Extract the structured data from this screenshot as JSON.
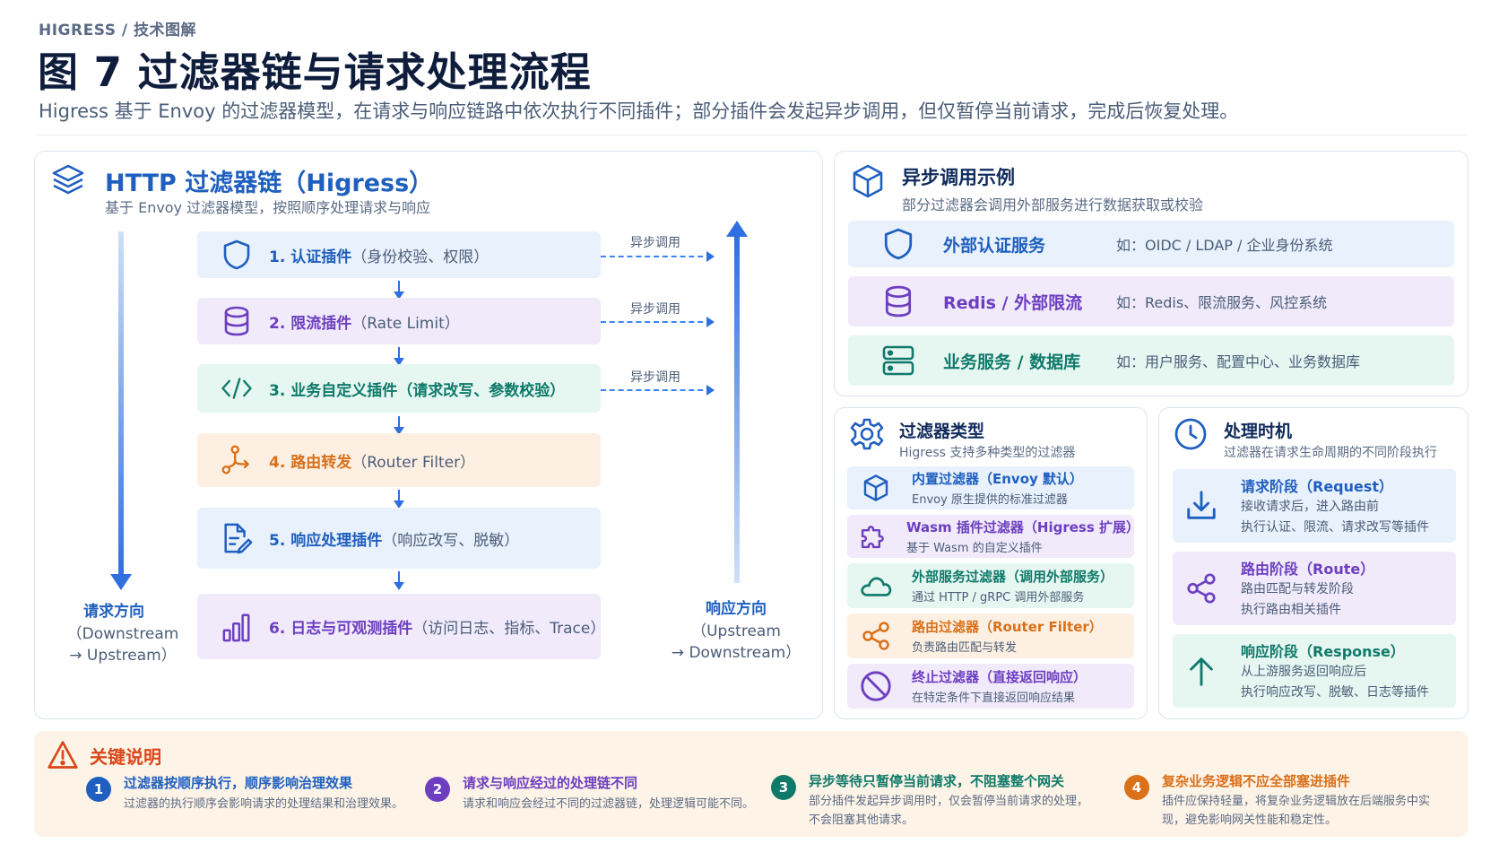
{
  "header": {
    "breadcrumb": "HIGRESS / 技术图解",
    "title": "图 7  过滤器链与请求处理流程",
    "subtitle": "Higress 基于 Envoy 的过滤器模型，在请求与响应链路中依次执行不同插件；部分插件会发起异步调用，但仅暂停当前请求，完成后恢复处理。"
  },
  "chain": {
    "title": "HTTP 过滤器链（Higress）",
    "subtitle": "基于 Envoy 过滤器模型，按照顺序处理请求与响应",
    "steps": [
      {
        "name": "1. 认证插件",
        "desc": "（身份校验、权限）",
        "icon": "shield-icon",
        "color": "#1f5fbf",
        "bg": "#e8f1fc"
      },
      {
        "name": "2. 限流插件",
        "desc": "（Rate Limit）",
        "icon": "database-icon",
        "color": "#6d3fc0",
        "bg": "#f0eafb"
      },
      {
        "name": "3. 业务自定义插件（请求改写、参数校验）",
        "desc": "",
        "icon": "code-icon",
        "color": "#0f7a6a",
        "bg": "#e6f6f1"
      },
      {
        "name": "4. 路由转发",
        "desc": "（Router Filter）",
        "icon": "route-icon",
        "color": "#d9701a",
        "bg": "#fdf0e2"
      },
      {
        "name": "5. 响应处理插件",
        "desc": "（响应改写、脱敏）",
        "icon": "document-edit-icon",
        "color": "#1f5fbf",
        "bg": "#e8f1fc"
      },
      {
        "name": "6. 日志与可观测插件",
        "desc": "（访问日志、指标、Trace）",
        "icon": "bar-chart-icon",
        "color": "#6d3fc0",
        "bg": "#f0eafb"
      }
    ],
    "async_label": "异步调用",
    "request_dir": {
      "title": "请求方向",
      "line1": "（Downstream",
      "line2": "→ Upstream）"
    },
    "response_dir": {
      "title": "响应方向",
      "line1": "（Upstream",
      "line2": "→ Downstream）"
    }
  },
  "async": {
    "title": "异步调用示例",
    "subtitle": "部分过滤器会调用外部服务进行数据获取或校验",
    "services": [
      {
        "name": "外部认证服务",
        "example": "如：OIDC / LDAP / 企业身份系统",
        "icon": "shield-icon",
        "color": "#1f5fbf",
        "bg": "#e8f1fc"
      },
      {
        "name": "Redis / 外部限流",
        "example": "如：Redis、限流服务、风控系统",
        "icon": "database-icon",
        "color": "#6d3fc0",
        "bg": "#f0eafb"
      },
      {
        "name": "业务服务 / 数据库",
        "example": "如：用户服务、配置中心、业务数据库",
        "icon": "server-icon",
        "color": "#0f7a6a",
        "bg": "#e6f6f1"
      }
    ]
  },
  "types": {
    "title": "过滤器类型",
    "subtitle": "Higress 支持多种类型的过滤器",
    "items": [
      {
        "name": "内置过滤器（Envoy 默认）",
        "desc": "Envoy 原生提供的标准过滤器",
        "icon": "cube-icon",
        "color": "#1f5fbf",
        "bg": "#e8f1fc"
      },
      {
        "name": "Wasm 插件过滤器（Higress 扩展）",
        "desc": "基于 Wasm 的自定义插件",
        "icon": "puzzle-icon",
        "color": "#6d3fc0",
        "bg": "#f0eafb"
      },
      {
        "name": "外部服务过滤器（调用外部服务）",
        "desc": "通过 HTTP / gRPC 调用外部服务",
        "icon": "cloud-icon",
        "color": "#0f7a6a",
        "bg": "#e6f6f1"
      },
      {
        "name": "路由过滤器（Router Filter）",
        "desc": "负责路由匹配与转发",
        "icon": "share-icon",
        "color": "#d9701a",
        "bg": "#fdf0e2"
      },
      {
        "name": "终止过滤器（直接返回响应）",
        "desc": "在特定条件下直接返回响应结果",
        "icon": "block-icon",
        "color": "#6d3fc0",
        "bg": "#f0eafb"
      }
    ]
  },
  "timing": {
    "title": "处理时机",
    "subtitle": "过滤器在请求生命周期的不同阶段执行",
    "phases": [
      {
        "name": "请求阶段（Request）",
        "line1": "接收请求后，进入路由前",
        "line2": "执行认证、限流、请求改写等插件",
        "icon": "download-icon",
        "color": "#1f5fbf",
        "bg": "#e8f1fc"
      },
      {
        "name": "路由阶段（Route）",
        "line1": "路由匹配与转发阶段",
        "line2": "执行路由相关插件",
        "icon": "share-icon",
        "color": "#6d3fc0",
        "bg": "#f0eafb"
      },
      {
        "name": "响应阶段（Response）",
        "line1": "从上游服务返回响应后",
        "line2": "执行响应改写、脱敏、日志等插件",
        "icon": "arrow-up-icon",
        "color": "#0f7a6a",
        "bg": "#e6f6f1"
      }
    ]
  },
  "notes": {
    "title": "关键说明",
    "items": [
      {
        "num": "1",
        "head": "过滤器按顺序执行，顺序影响治理效果",
        "body": "过滤器的执行顺序会影响请求的处理结果和治理效果。",
        "color": "#1f5fbf"
      },
      {
        "num": "2",
        "head": "请求与响应经过的处理链不同",
        "body": "请求和响应会经过不同的过滤器链，处理逻辑可能不同。",
        "color": "#6d3fc0"
      },
      {
        "num": "3",
        "head": "异步等待只暂停当前请求，不阻塞整个网关",
        "body": "部分插件发起异步调用时，仅会暂停当前请求的处理，不会阻塞其他请求。",
        "color": "#0f7a6a"
      },
      {
        "num": "4",
        "head": "复杂业务逻辑不应全部塞进插件",
        "body": "插件应保持轻量，将复杂业务逻辑放在后端服务中实现，避免影响网关性能和稳定性。",
        "color": "#d9701a"
      }
    ]
  },
  "colors": {
    "primary": "#1f5fbf",
    "purple": "#6d3fc0",
    "teal": "#0f7a6a",
    "orange": "#d9701a",
    "warn": "#d9481a"
  }
}
